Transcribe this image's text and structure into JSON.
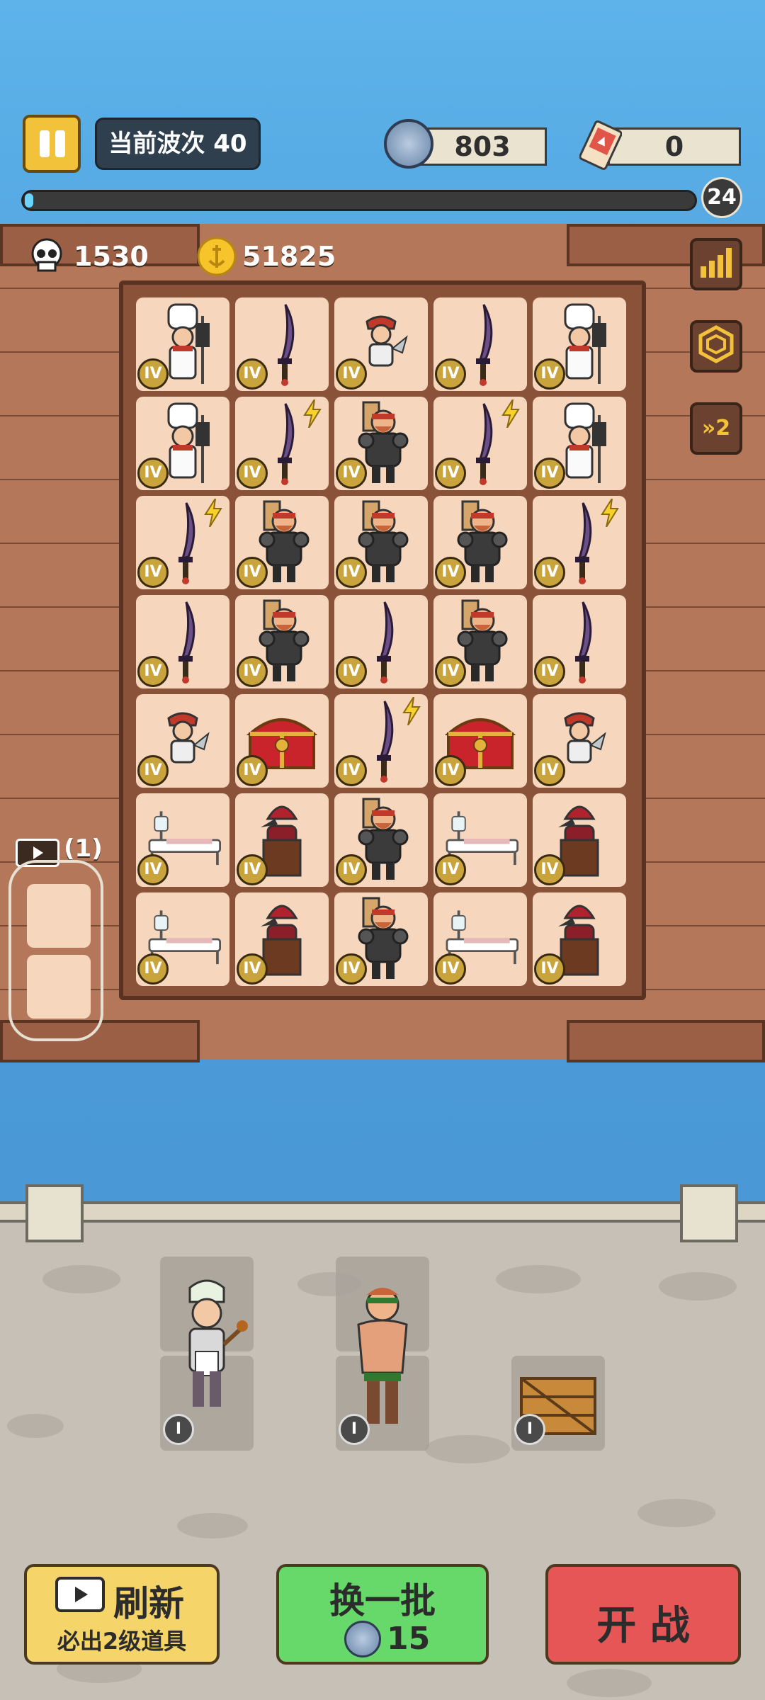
{
  "hud": {
    "wave_label": "当前波次 40",
    "skull_coins": "803",
    "tickets": "0",
    "wave_number": "24",
    "wave_progress": 0.01
  },
  "deck": {
    "kills": "1530",
    "gold": "51825"
  },
  "side_buttons": {
    "speed": "»2"
  },
  "board": {
    "level_label": "IV",
    "rows": [
      [
        "chef",
        "sword",
        "pirate",
        "sword",
        "chef"
      ],
      [
        "chef",
        "sword",
        "brute",
        "sword",
        "chef"
      ],
      [
        "sword",
        "brute",
        "brute",
        "brute",
        "sword"
      ],
      [
        "sword",
        "brute",
        "sword",
        "brute",
        "sword"
      ],
      [
        "pirate",
        "chest",
        "sword",
        "chest",
        "pirate"
      ],
      [
        "bed",
        "witch",
        "brute",
        "bed",
        "witch"
      ],
      [
        "bed",
        "witch",
        "brute",
        "bed",
        "witch"
      ]
    ]
  },
  "storage": {
    "ad_count": "(1)"
  },
  "shop": {
    "level_label": "I",
    "items": [
      "cook",
      "fighter",
      "crate"
    ]
  },
  "buttons": {
    "refresh_title": "刷新",
    "refresh_sub": "必出2级道具",
    "reroll_title": "换一批",
    "reroll_cost": "15",
    "battle": "开 战"
  },
  "colors": {
    "refresh": "#f5d46a",
    "reroll": "#66d96a",
    "battle": "#e65656",
    "cell": "#f6d6bd",
    "level_badge": "#c9a33c"
  }
}
